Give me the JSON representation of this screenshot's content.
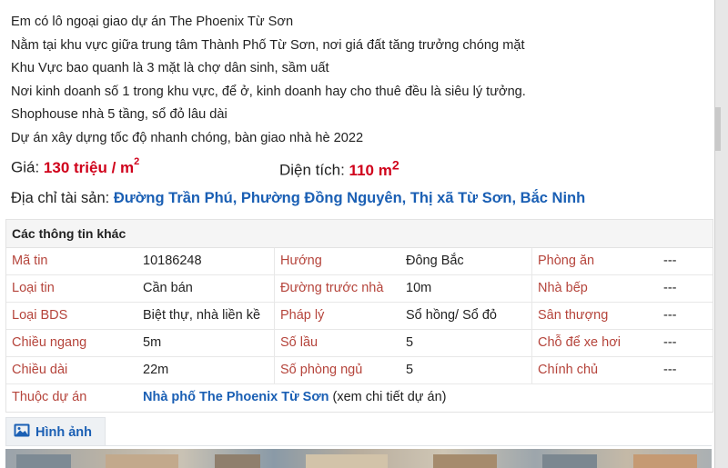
{
  "description_lines": [
    "Em có lô ngoại giao dự án The Phoenix Từ Sơn",
    "Nằm tại khu vực giữa trung tâm Thành Phố Từ Sơn, nơi giá đất tăng trưởng chóng mặt",
    "Khu Vực bao quanh là 3 mặt là chợ dân sinh, sầm uất",
    "Nơi kinh doanh số 1 trong khu vực, để ở, kinh doanh hay cho thuê đều là siêu lý tưởng.",
    "Shophouse nhà 5 tầng, sổ đỏ lâu dài",
    "Dự án xây dựng tốc độ nhanh chóng, bàn giao nhà hè 2022"
  ],
  "price": {
    "label": "Giá:",
    "value": "130 triệu / m",
    "sup": "2"
  },
  "area": {
    "label": "Diện tích:",
    "value": "110 m",
    "sup": "2"
  },
  "address": {
    "label": "Địa chỉ tài sản:",
    "value": "Đường Trần Phú, Phường Đồng Nguyên, Thị xã Từ Sơn, Bắc Ninh"
  },
  "info_table": {
    "title": "Các thông tin khác",
    "rows": [
      [
        "Mã tin",
        "10186248",
        "Hướng",
        "Đông Bắc",
        "Phòng ăn",
        "---"
      ],
      [
        "Loại tin",
        "Cần bán",
        "Đường trước nhà",
        "10m",
        "Nhà bếp",
        "---"
      ],
      [
        "Loại BDS",
        "Biệt thự, nhà liền kề",
        "Pháp lý",
        "Sổ hồng/ Sổ đỏ",
        "Sân thượng",
        "---"
      ],
      [
        "Chiều ngang",
        "5m",
        "Số lầu",
        "5",
        "Chỗ để xe hơi",
        "---"
      ],
      [
        "Chiều dài",
        "22m",
        "Số phòng ngủ",
        "5",
        "Chính chủ",
        "---"
      ]
    ],
    "project": {
      "label": "Thuộc dự án",
      "value": "Nhà phố The Phoenix Từ Sơn",
      "hint": "(xem chi tiết dự án)"
    }
  },
  "images_tab": {
    "label": "Hình ảnh",
    "icon": "image-icon"
  },
  "colors": {
    "key": "#b5443b",
    "accent": "#d0021b",
    "link": "#1a5fb4"
  }
}
